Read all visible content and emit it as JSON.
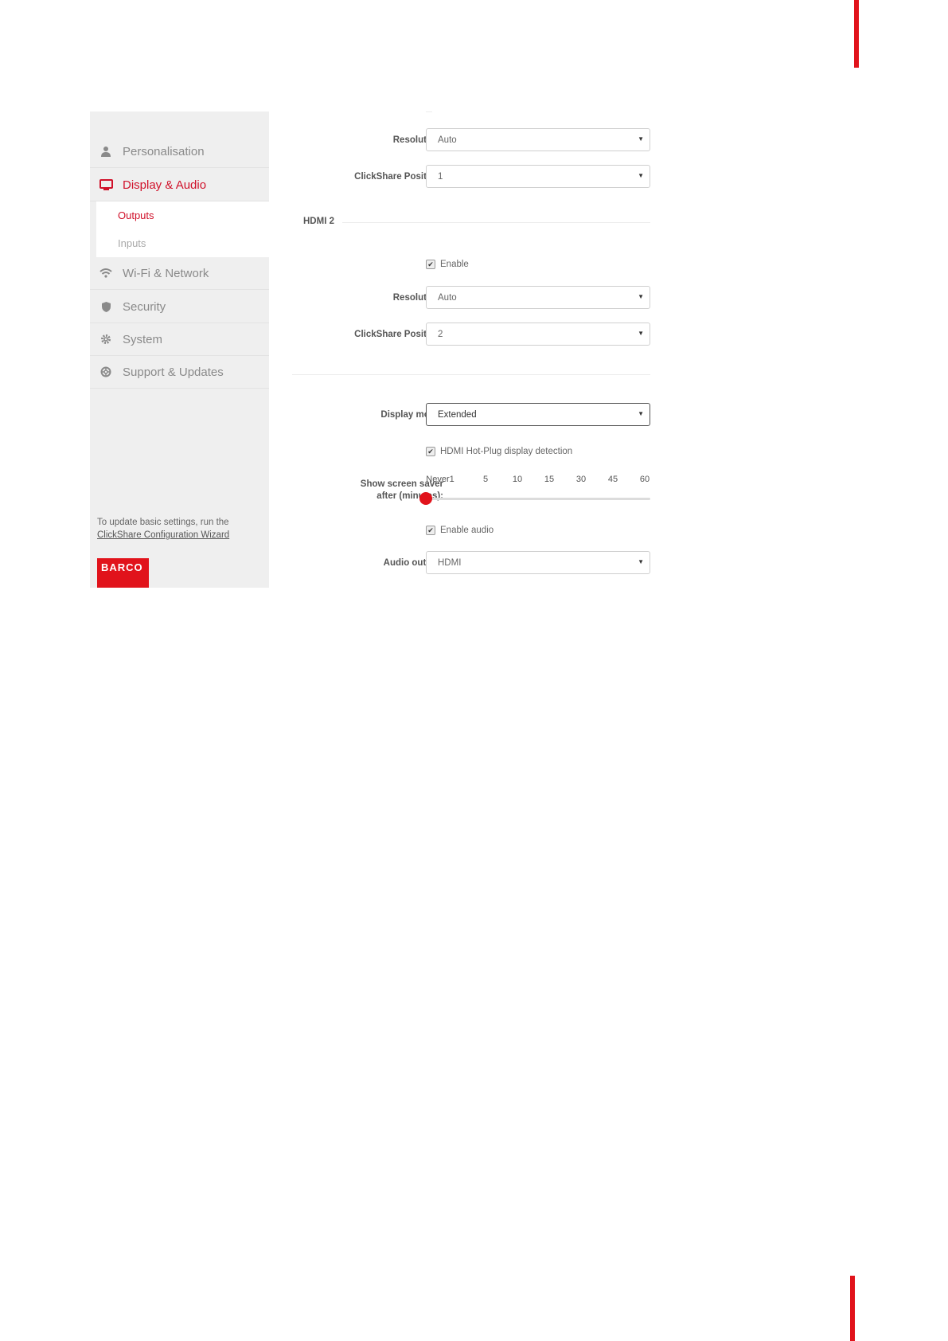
{
  "sidebar": {
    "items": [
      {
        "label": "Personalisation",
        "icon": "user-icon"
      },
      {
        "label": "Display & Audio",
        "icon": "monitor-icon",
        "active": true
      },
      {
        "label": "Wi-Fi & Network",
        "icon": "wifi-icon"
      },
      {
        "label": "Security",
        "icon": "shield-icon"
      },
      {
        "label": "System",
        "icon": "gear-icon"
      },
      {
        "label": "Support & Updates",
        "icon": "lifebuoy-icon"
      }
    ],
    "subitems": [
      {
        "label": "Outputs",
        "active": true
      },
      {
        "label": "Inputs"
      }
    ],
    "hint_text": "To update basic settings, run the",
    "hint_link": "ClickShare Configuration Wizard",
    "logo_text": "BARCO"
  },
  "hdmi1": {
    "resolution_label": "Resolution:",
    "resolution_value": "Auto",
    "position_label": "ClickShare Position:",
    "position_value": "1"
  },
  "hdmi2": {
    "title": "HDMI 2",
    "enable_label": "Enable",
    "enable_checked": true,
    "resolution_label": "Resolution:",
    "resolution_value": "Auto",
    "position_label": "ClickShare Position:",
    "position_value": "2"
  },
  "display": {
    "mode_label": "Display mode:",
    "mode_value": "Extended",
    "hotplug_label": "HDMI Hot-Plug display detection",
    "hotplug_checked": true,
    "screensaver_label_1": "Show screen saver",
    "screensaver_label_2": "after (minutes):",
    "screensaver_ticks": [
      "Never1",
      "5",
      "10",
      "15",
      "30",
      "45",
      "60"
    ],
    "screensaver_value": "Never",
    "audio_enable_label": "Enable audio",
    "audio_enabled": true,
    "audio_output_label": "Audio output:",
    "audio_output_value": "HDMI"
  },
  "colors": {
    "accent": "#e1131b",
    "active_text": "#d0112a"
  }
}
